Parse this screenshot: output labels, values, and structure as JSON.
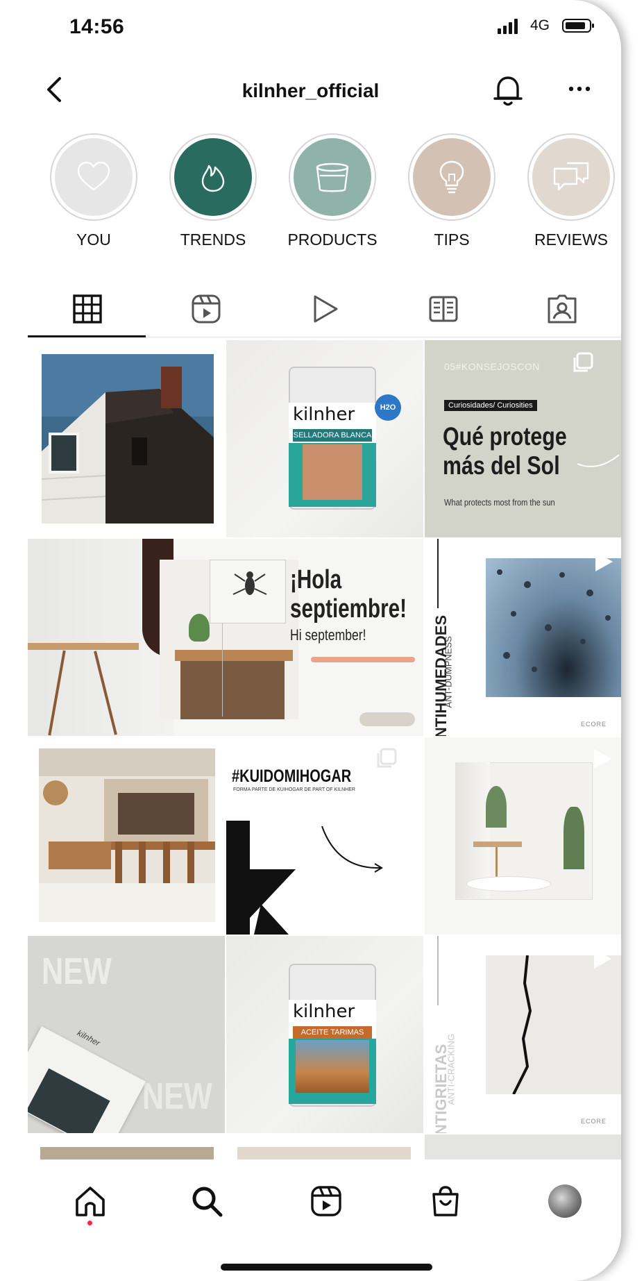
{
  "status_bar": {
    "time": "14:56",
    "network": "4G"
  },
  "header": {
    "username": "kilnher_official"
  },
  "highlights": [
    {
      "label": "YOU",
      "icon": "heart-icon",
      "color": "#e6e6e6"
    },
    {
      "label": "TRENDS",
      "icon": "flame-icon",
      "color": "#2a6b5f"
    },
    {
      "label": "PRODUCTS",
      "icon": "bucket-icon",
      "color": "#8fb3a9"
    },
    {
      "label": "TIPS",
      "icon": "lightbulb-icon",
      "color": "#d3c2b4"
    },
    {
      "label": "REVIEWS",
      "icon": "chat-bubbles-icon",
      "color": "#e1d8d0"
    }
  ],
  "profile_tabs": [
    "grid-icon",
    "reels-icon",
    "play-icon",
    "guide-icon",
    "tagged-icon"
  ],
  "posts": {
    "p1": {
      "caption": "house-photo"
    },
    "p2": {
      "brand": "kilnher",
      "product": "SELLADORA BLANCA",
      "badge": "H2O"
    },
    "p3": {
      "hashtag": "05#KONSEJOSCON",
      "tag": "Curiosidades/ Curiosities",
      "title_1": "Qué protege",
      "title_2": "más del Sol",
      "subtitle": "What protects most from the sun"
    },
    "p4": {
      "title_1": "¡Hola",
      "title_2": "septiembre!",
      "subtitle": "Hi september!"
    },
    "p5": {
      "vertical_1": "ANTIHUMEDADES",
      "vertical_2": "ANT-DUMPNESS",
      "brand": "ECORE"
    },
    "p7": {
      "hashtag": "#KUIDOMIHOGAR",
      "small": "FORMA PARTE DE KUIHOGAR DE PART OF KILNHER"
    },
    "p9": {
      "overlay_1": "NEW",
      "overlay_2": "NEW",
      "mag": "kilnher"
    },
    "p10": {
      "brand": "kilnher",
      "product": "ACEITE TARIMAS"
    },
    "p11": {
      "vertical_1": "ANTIGRIETAS",
      "vertical_2": "ANTI-CRACKING",
      "brand": "ECORE"
    }
  },
  "colors": {
    "accent_dark_green": "#2a6b5f",
    "notification_dot": "#ee2b3b"
  }
}
